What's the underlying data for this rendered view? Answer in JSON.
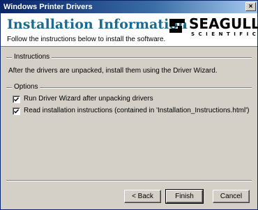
{
  "window": {
    "title": "Windows Printer Drivers",
    "close_label": "×"
  },
  "header": {
    "title": "Installation Information",
    "subtitle": "Follow the instructions below to install the software.",
    "logo_word": "SEAGULL",
    "logo_sub": "SCIENTIFIC",
    "accent_color": "#1a6b8f"
  },
  "instructions": {
    "group_label": "Instructions",
    "text": "After the drivers are unpacked, install them using the Driver Wizard."
  },
  "options": {
    "group_label": "Options",
    "items": [
      {
        "label": "Run Driver Wizard after unpacking drivers",
        "checked": true
      },
      {
        "label": "Read installation instructions (contained in 'Installation_Instructions.html')",
        "checked": true
      }
    ]
  },
  "buttons": {
    "back": "< Back",
    "finish": "Finish",
    "cancel": "Cancel"
  }
}
